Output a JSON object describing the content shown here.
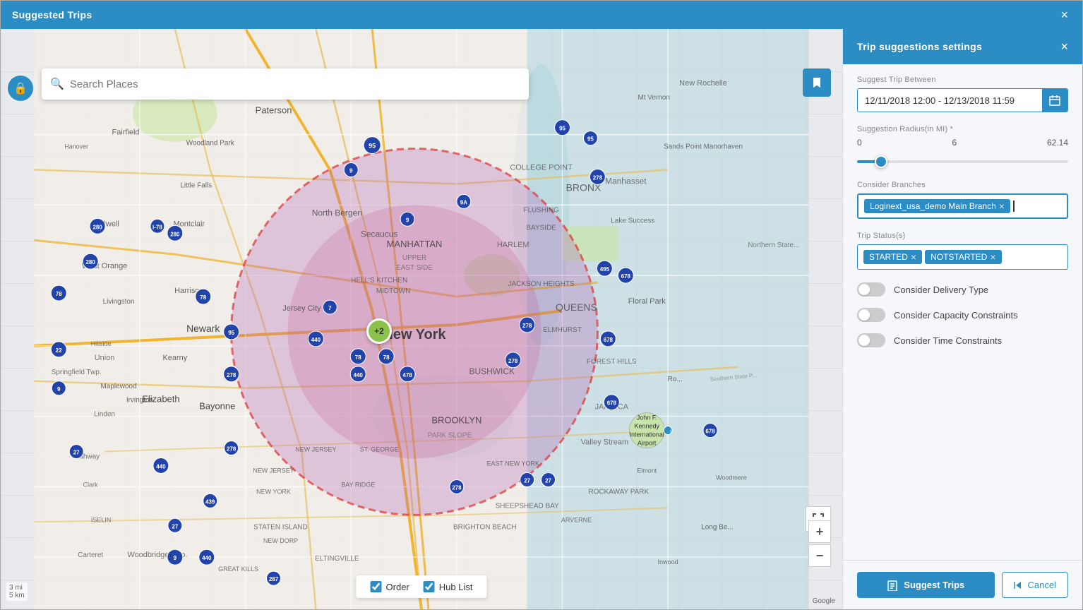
{
  "window": {
    "title": "Suggested Trips",
    "close_label": "×"
  },
  "map": {
    "search_placeholder": "Search Places",
    "marker_label": "+2",
    "map_btn_icon": "🔖",
    "lock_icon": "🔒",
    "fullscreen_icon": "⛶",
    "zoom_in": "+",
    "zoom_out": "−",
    "legend": {
      "order_label": "Order",
      "hub_list_label": "Hub List"
    },
    "scale_label": "3 mi",
    "scale_label2": "5 km",
    "google_label": "Google"
  },
  "settings": {
    "title": "Trip suggestions settings",
    "close_label": "×",
    "suggest_trip_between_label": "Suggest Trip Between",
    "date_range": "12/11/2018 12:00 - 12/13/2018 11:59",
    "suggestion_radius_label": "Suggestion Radius(in MI) *",
    "radius_min": "0",
    "radius_value": "6",
    "radius_max": "62.14",
    "consider_branches_label": "Consider Branches",
    "branch_tag": "Loginext_usa_demo Main Branch",
    "trip_status_label": "Trip Status(s)",
    "status_tag_1": "STARTED",
    "status_tag_2": "NOTSTARTED",
    "consider_delivery_type_label": "Consider Delivery Type",
    "consider_capacity_label": "Consider Capacity Constraints",
    "consider_time_label": "Consider Time Constraints",
    "suggest_trips_label": "Suggest Trips",
    "cancel_label": "Cancel",
    "suggest_icon": "📋",
    "cancel_icon": "↩"
  }
}
